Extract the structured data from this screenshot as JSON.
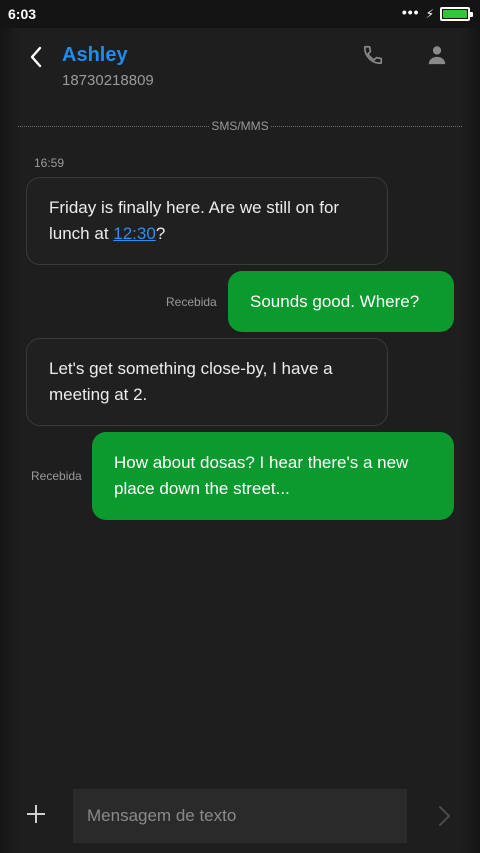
{
  "status_bar": {
    "time": "6:03",
    "battery_level": 1.0,
    "battery_color": "#34c634"
  },
  "header": {
    "contact_name": "Ashley",
    "contact_number": "18730218809",
    "name_color": "#1e8cf0"
  },
  "conversation": {
    "channel_label": "SMS/MMS",
    "timestamp": "16:59",
    "messages": [
      {
        "direction": "incoming",
        "text_before": "Friday is finally here. Are we still on for lunch at ",
        "link": "12:30",
        "text_after": "?"
      },
      {
        "direction": "outgoing",
        "text": "Sounds good. Where?",
        "status": "Recebida"
      },
      {
        "direction": "incoming",
        "text": "Let's get something close-by, I have a meeting at 2."
      },
      {
        "direction": "outgoing",
        "text": "How about dosas? I hear there's a new place down the street...",
        "status": "Recebida"
      }
    ]
  },
  "composer": {
    "placeholder": "Mensagem de texto",
    "value": ""
  },
  "icons": {
    "back": "chevron-left-icon",
    "call": "phone-icon",
    "profile": "person-icon",
    "add": "plus-icon",
    "send": "chevron-right-icon"
  },
  "colors": {
    "outgoing_bubble": "#0a9a2e",
    "incoming_bubble": "#202020",
    "link": "#2b8ff5"
  }
}
